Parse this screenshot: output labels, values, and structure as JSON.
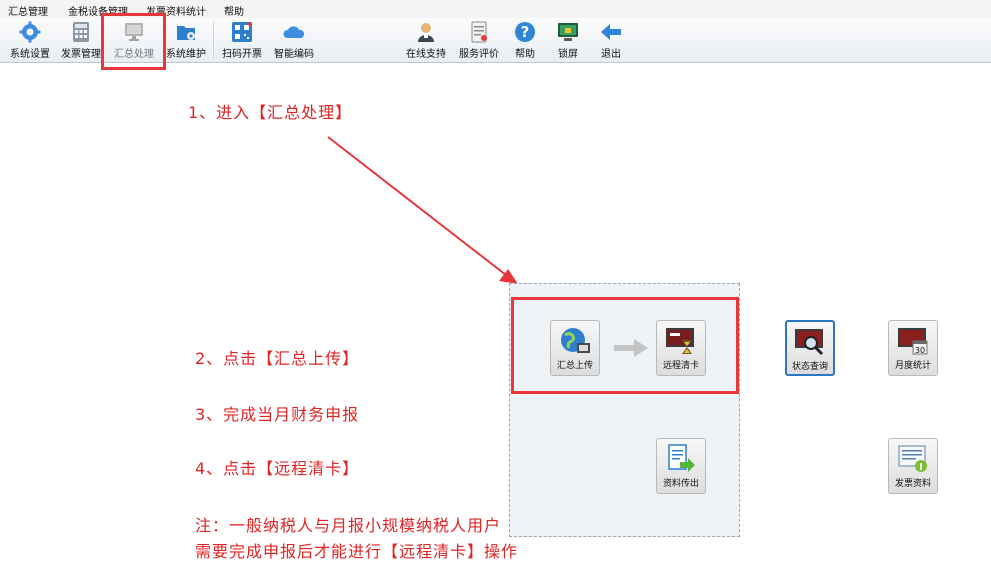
{
  "menu": [
    "汇总管理",
    "金税设备管理",
    "发票资料统计",
    "帮助"
  ],
  "toolbar": {
    "items": [
      "系统设置",
      "发票管理",
      "汇总处理",
      "系统维护",
      "扫码开票",
      "智能编码",
      "在线支持",
      "服务评价",
      "帮助",
      "锁屏",
      "退出"
    ]
  },
  "steps": {
    "s1": "1、进入【汇总处理】",
    "s2": "2、点击【汇总上传】",
    "s3": "3、完成当月财务申报",
    "s4": "4、点击【远程清卡】",
    "note1": "注：一般纳税人与月报小规模纳税人用户",
    "note2": "需要完成申报后才能进行【远程清卡】操作"
  },
  "functions": {
    "upload": "汇总上传",
    "clear": "远程清卡",
    "status": "状态查询",
    "monthly": "月度统计",
    "export": "资料传出",
    "invoice": "发票资料",
    "calendar_day": "30"
  },
  "colors": {
    "annotation": "#e02424",
    "frame": "#e8373a",
    "active_border": "#2d76c6"
  }
}
